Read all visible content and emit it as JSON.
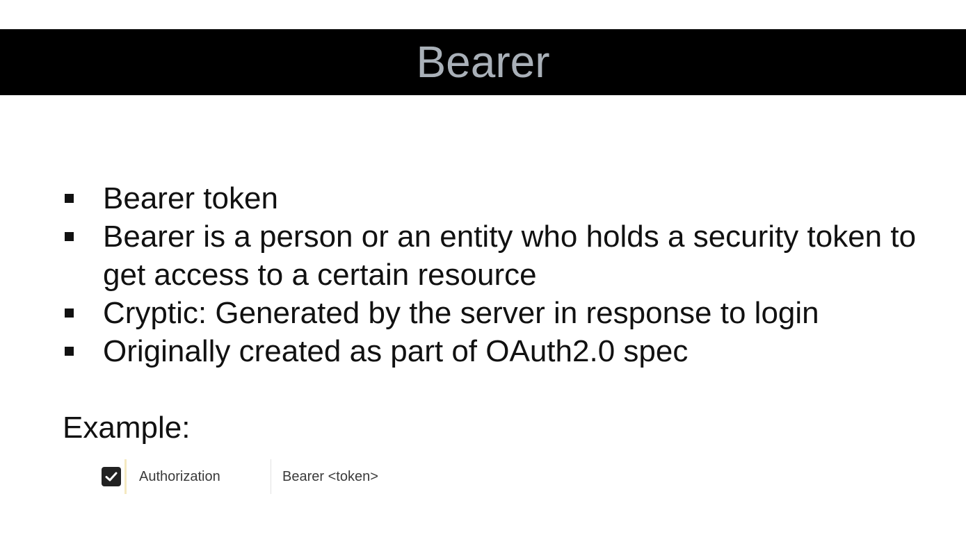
{
  "slide": {
    "title": "Bearer",
    "bullets": [
      "Bearer token",
      "Bearer is a person or an entity who holds a security token to get access to a certain resource",
      "Cryptic: Generated by the server in response to login",
      "Originally created as part of OAuth2.0 spec"
    ],
    "example_label": "Example:"
  },
  "example_header": {
    "checked": true,
    "key": "Authorization",
    "value": "Bearer <token>"
  },
  "colors": {
    "title_bar": "#000000",
    "title_text": "#a9b0b8",
    "body_text": "#111111"
  }
}
